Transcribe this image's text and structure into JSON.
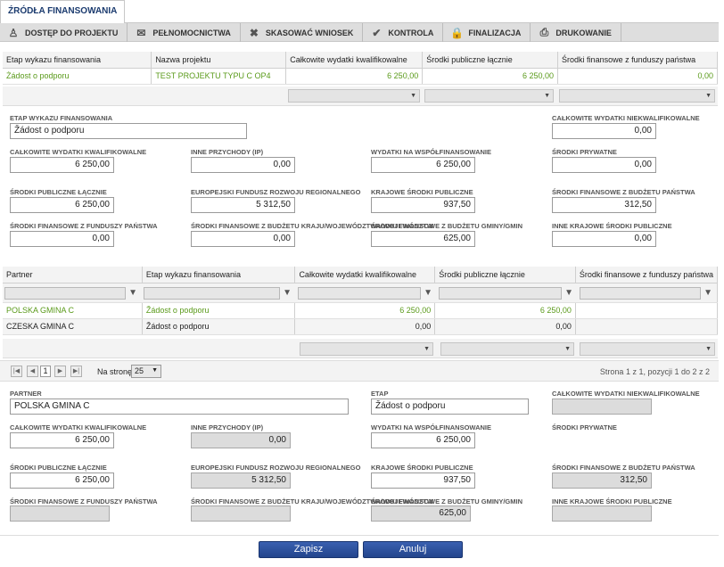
{
  "tab_title": "ŹRÓDŁA FINANSOWANIA",
  "toolbar": [
    {
      "label": "DOSTĘP DO PROJEKTU",
      "icon": "people-icon"
    },
    {
      "label": "PEŁNOMOCNICTWA",
      "icon": "envelope-icon"
    },
    {
      "label": "SKASOWAĆ WNIOSEK",
      "icon": "close-icon"
    },
    {
      "label": "KONTROLA",
      "icon": "check-icon"
    },
    {
      "label": "FINALIZACJA",
      "icon": "lock-icon"
    },
    {
      "label": "DRUKOWANIE",
      "icon": "printer-icon"
    }
  ],
  "grid1": {
    "headers": [
      "Etap wykazu finansowania",
      "Nazwa projektu",
      "Całkowite wydatki kwalifikowalne",
      "Środki publiczne łącznie",
      "Środki finansowe z funduszy państwa"
    ],
    "row": [
      "Żádost o podporu",
      "TEST PROJEKTU TYPU C OP4",
      "6 250,00",
      "6 250,00",
      "0,00"
    ]
  },
  "form1": {
    "etap_label": "ETAP WYKAZU FINANSOWANIA",
    "etap": "Žádost o podporu",
    "cwn_label": "CAŁKOWITE WYDATKI NIEKWALIFIKOWALNE",
    "cwn": "0,00",
    "cwk_label": "CAŁKOWITE WYDATKI KWALIFIKOWALNE",
    "cwk": "6 250,00",
    "ip_label": "INNE PRZYCHODY (IP)",
    "ip": "0,00",
    "wnw_label": "WYDATKI NA WSPÓŁFINANSOWANIE",
    "wnw": "6 250,00",
    "sp_label": "ŚRODKI PRYWATNE",
    "sp": "0,00",
    "spl_label": "ŚRODKI PUBLICZNE ŁĄCZNIE",
    "spl": "6 250,00",
    "efrr_label": "EUROPEJSKI FUNDUSZ ROZWOJU REGIONALNEGO",
    "efrr": "5 312,50",
    "ksp_label": "KRAJOWE ŚRODKI PUBLICZNE",
    "ksp": "937,50",
    "sfbp_label": "ŚRODKI FINANSOWE Z BUDŻETU PAŃSTWA",
    "sfbp": "312,50",
    "sffp_label": "ŚRODKI FINANSOWE Z FUNDUSZY PAŃSTWA",
    "sffp": "0,00",
    "sfbk_label": "ŚRODKI FINANSOWE Z BUDŻETU KRAJU/WOJEWÓDZTWA/WOJEWÓDZTW",
    "sfbk": "0,00",
    "sfbg_label": "ŚRODKI FINANSOWE Z BUDŻETU GMINY/GMIN",
    "sfbg": "625,00",
    "iksp_label": "INNE KRAJOWE ŚRODKI PUBLICZNE",
    "iksp": "0,00"
  },
  "grid2": {
    "headers": [
      "Partner",
      "Etap wykazu finansowania",
      "Całkowite wydatki kwalifikowalne",
      "Środki publiczne łącznie",
      "Środki finansowe z funduszy państwa"
    ],
    "rows": [
      [
        "POLSKA GMINA C",
        "Žádost o podporu",
        "6 250,00",
        "6 250,00",
        ""
      ],
      [
        "CZESKA GMINA C",
        "Žádost o podporu",
        "0,00",
        "0,00",
        ""
      ]
    ]
  },
  "pager": {
    "page": "1",
    "per_page_label": "Na stronę",
    "per_page": "25",
    "summary": "Strona 1 z 1, pozycji 1 do 2 z 2"
  },
  "form2": {
    "partner_label": "PARTNER",
    "partner": "POLSKA GMINA C",
    "etap_label": "ETAP",
    "etap": "Žádost o podporu",
    "cwn_label": "CAŁKOWITE WYDATKI NIEKWALIFIKOWALNE",
    "cwn": "",
    "cwk_label": "CAŁKOWITE WYDATKI KWALIFIKOWALNE",
    "cwk": "6 250,00",
    "ip_label": "INNE PRZYCHODY (IP)",
    "ip": "0,00",
    "wnw_label": "WYDATKI NA WSPÓŁFINANSOWANIE",
    "wnw": "6 250,00",
    "sp_label": "ŚRODKI PRYWATNE",
    "sp": "",
    "spl_label": "ŚRODKI PUBLICZNE ŁĄCZNIE",
    "spl": "6 250,00",
    "efrr_label": "EUROPEJSKI FUNDUSZ ROZWOJU REGIONALNEGO",
    "efrr": "5 312,50",
    "ksp_label": "KRAJOWE ŚRODKI PUBLICZNE",
    "ksp": "937,50",
    "sfbp_label": "ŚRODKI FINANSOWE Z BUDŻETU PAŃSTWA",
    "sfbp": "312,50",
    "sffp_label": "ŚRODKI FINANSOWE Z FUNDUSZY PAŃSTWA",
    "sffp": "",
    "sfbk_label": "ŚRODKI FINANSOWE Z BUDŻETU KRAJU/WOJEWÓDZTWA/WOJEWÓDZTW",
    "sfbk": "",
    "sfbg_label": "ŚRODKI FINANSOWE Z BUDŻETU GMINY/GMIN",
    "sfbg": "625,00",
    "iksp_label": "INNE KRAJOWE ŚRODKI PUBLICZNE",
    "iksp": ""
  },
  "buttons": {
    "save": "Zapisz",
    "cancel": "Anuluj"
  }
}
